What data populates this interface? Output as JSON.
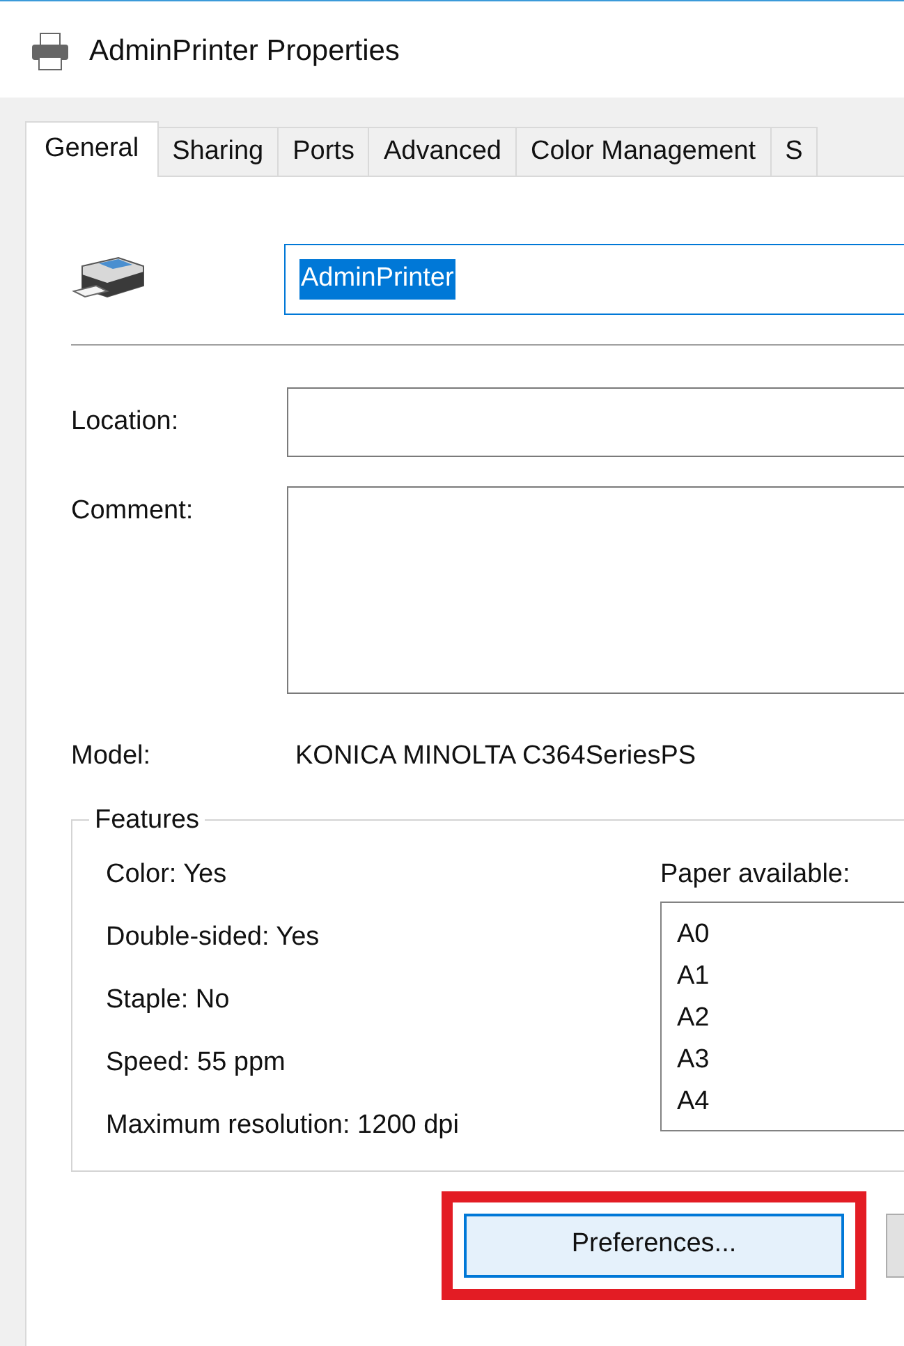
{
  "window": {
    "title": "AdminPrinter Properties"
  },
  "tabs": [
    {
      "label": "General",
      "selected": true
    },
    {
      "label": "Sharing",
      "selected": false
    },
    {
      "label": "Ports",
      "selected": false
    },
    {
      "label": "Advanced",
      "selected": false
    },
    {
      "label": "Color Management",
      "selected": false
    },
    {
      "label": "S",
      "selected": false
    }
  ],
  "printer_name": {
    "value": "AdminPrinter",
    "selected": true
  },
  "location": {
    "label": "Location:"
  },
  "comment": {
    "label": "Comment:"
  },
  "model": {
    "label": "Model:",
    "value": "KONICA MINOLTA C364SeriesPS"
  },
  "features": {
    "title": "Features",
    "items": [
      "Color: Yes",
      "Double-sided: Yes",
      "Staple: No",
      "Speed: 55 ppm",
      "Maximum resolution: 1200 dpi"
    ],
    "paper_label": "Paper available:",
    "paper": [
      "A0",
      "A1",
      "A2",
      "A3",
      "A4"
    ]
  },
  "buttons": [
    {
      "label": "Preferences...",
      "highlighted": true
    }
  ]
}
